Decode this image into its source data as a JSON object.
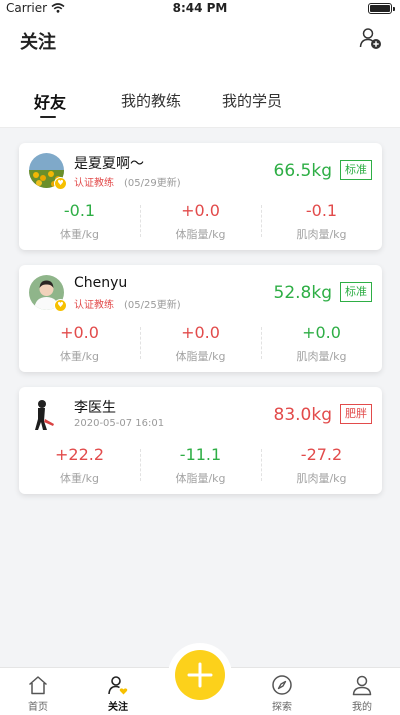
{
  "status": {
    "carrier": "Carrier",
    "time": "8:44 PM"
  },
  "header": {
    "title": "关注"
  },
  "tabs": [
    {
      "label": "好友",
      "active": true
    },
    {
      "label": "我的教练",
      "active": false
    },
    {
      "label": "我的学员",
      "active": false
    }
  ],
  "cards": [
    {
      "name": "是夏夏啊～",
      "cert": "认证教练",
      "updated": "(05/29更新)",
      "weight": "66.5kg",
      "status": "标准",
      "status_color": "#2eae45",
      "metrics": [
        {
          "value": "-0.1",
          "label": "体重/kg",
          "color": "#2eae45"
        },
        {
          "value": "+0.0",
          "label": "体脂量/kg",
          "color": "#e24b4b"
        },
        {
          "value": "-0.1",
          "label": "肌肉量/kg",
          "color": "#e24b4b"
        }
      ]
    },
    {
      "name": "Chenyu",
      "cert": "认证教练",
      "updated": "(05/25更新)",
      "weight": "52.8kg",
      "status": "标准",
      "status_color": "#2eae45",
      "metrics": [
        {
          "value": "+0.0",
          "label": "体重/kg",
          "color": "#e24b4b"
        },
        {
          "value": "+0.0",
          "label": "体脂量/kg",
          "color": "#e24b4b"
        },
        {
          "value": "+0.0",
          "label": "肌肉量/kg",
          "color": "#2eae45"
        }
      ]
    },
    {
      "name": "李医生",
      "date": "2020-05-07 16:01",
      "weight": "83.0kg",
      "status": "肥胖",
      "status_color": "#e24b4b",
      "metrics": [
        {
          "value": "+22.2",
          "label": "体重/kg",
          "color": "#e24b4b"
        },
        {
          "value": "-11.1",
          "label": "体脂量/kg",
          "color": "#2eae45"
        },
        {
          "value": "-27.2",
          "label": "肌肉量/kg",
          "color": "#e24b4b"
        }
      ]
    }
  ],
  "tabbar": {
    "home": "首页",
    "follow": "关注",
    "explore": "探索",
    "mine": "我的"
  },
  "icons": [
    "wifi-icon",
    "battery-icon",
    "add-friend-icon",
    "home-icon",
    "follow-icon",
    "add-icon",
    "compass-icon",
    "profile-icon"
  ]
}
